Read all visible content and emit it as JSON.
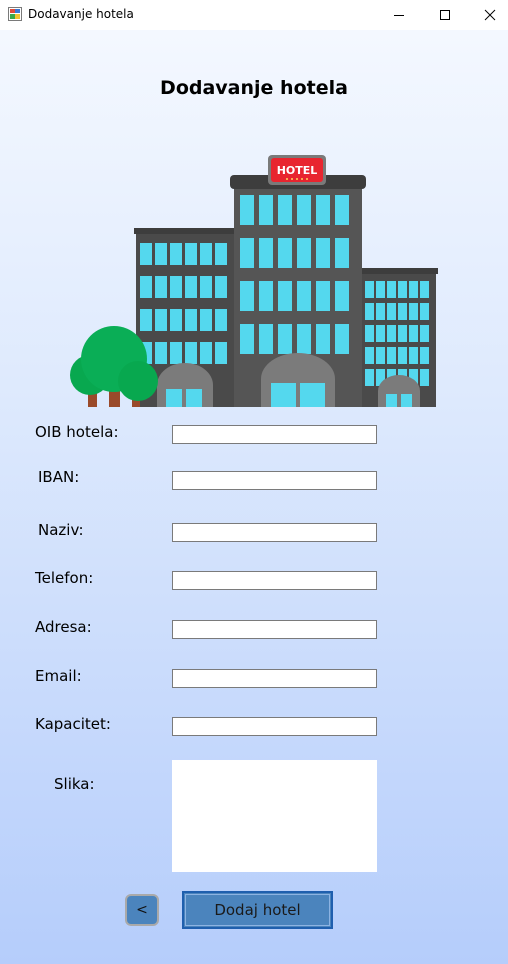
{
  "window": {
    "title": "Dodavanje hotela"
  },
  "title_bar_buttons": [
    "minimize-icon",
    "maximize-icon",
    "close-icon"
  ],
  "page": {
    "heading": "Dodavanje hotela"
  },
  "hotel_image": {
    "sign_text": "HOTEL"
  },
  "form": {
    "oib_label": "OIB hotela:",
    "oib_value": "",
    "iban_label": "IBAN:",
    "iban_value": "",
    "naziv_label": "Naziv:",
    "naziv_value": "",
    "telefon_label": "Telefon:",
    "telefon_value": "",
    "adresa_label": "Adresa:",
    "adresa_value": "",
    "email_label": "Email:",
    "email_value": "",
    "kapacitet_label": "Kapacitet:",
    "kapacitet_value": "",
    "slika_label": "Slika:"
  },
  "buttons": {
    "back_label": "<",
    "add_label": "Dodaj hotel"
  },
  "colors": {
    "button_fill": "#4b84bd",
    "building_dark": "#4a4a4a",
    "window_cyan": "#54d8ee",
    "tree_green": "#08a84f",
    "sign_red": "#e8252f"
  }
}
